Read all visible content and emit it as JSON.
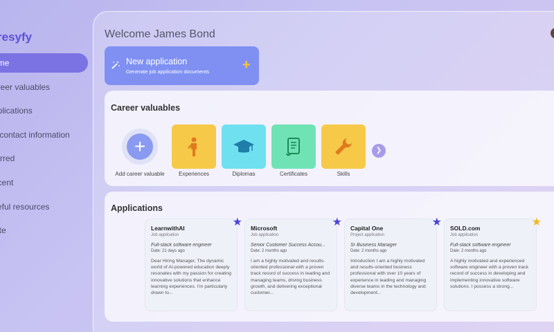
{
  "brand": {
    "name": "resyfy"
  },
  "nav": {
    "items": [
      {
        "label": "ome",
        "active": true
      },
      {
        "label": "areer valuables",
        "active": false
      },
      {
        "label": "pplications",
        "active": false
      },
      {
        "label": "y contact information",
        "active": false
      },
      {
        "label": "tarred",
        "active": false
      },
      {
        "label": "ecent",
        "active": false
      },
      {
        "label": "seful resources",
        "active": false
      },
      {
        "label": "vite",
        "active": false
      }
    ]
  },
  "header": {
    "welcome": "Welcome James Bond"
  },
  "new_application": {
    "title": "New application",
    "subtitle": "Generate job application documents",
    "icon": "magic-wand-icon",
    "action_icon": "plus-icon"
  },
  "career": {
    "title": "Career valuables",
    "add_label": "Add career valuable",
    "tiles": [
      {
        "label": "Experiences",
        "icon": "person-icon",
        "color": "#f7c948"
      },
      {
        "label": "Diplomas",
        "icon": "graduation-cap-icon",
        "color": "#6fe0f0"
      },
      {
        "label": "Certificates",
        "icon": "scroll-icon",
        "color": "#6fe3b4"
      },
      {
        "label": "Skills",
        "icon": "wrench-icon",
        "color": "#f7c948"
      }
    ]
  },
  "applications": {
    "title": "Applications",
    "cards": [
      {
        "company": "LearnwithAI",
        "type": "Job application",
        "role": "Full-stack software engineer",
        "date": "Date: 21 days ago",
        "body": "Dear Hiring Manager, The dynamic world of AI-powered education deeply resonates with my passion for creating innovative solutions that enhance learning experiences. I'm particularly drawn to...",
        "star_color": "#4b45d6"
      },
      {
        "company": "Microsoft",
        "type": "Job application",
        "role": "Senior Customer Success Accou...",
        "date": "Date: 2 months ago",
        "body": "I am a highly motivated and results-oriented professional with a proven track record of success in leading and managing teams, driving business growth, and delivering exceptional customer...",
        "star_color": "#4b45d6"
      },
      {
        "company": "Capital One",
        "type": "Project application",
        "role": "Sr Business Manager",
        "date": "Date: 2 months ago",
        "body": "Introduction I am a highly motivated and results-oriented business professional with over 10 years of experience in leading and managing diverse teams in the technology and development...",
        "star_color": "#4b45d6"
      },
      {
        "company": "SOLD.com",
        "type": "Job application",
        "role": "Full-stack software engineer",
        "date": "Date: 2 months ago",
        "body": "A highly motivated and experienced software engineer with a proven track record of success in developing and implementing innovative software solutions. I possess a strong...",
        "star_color": "#f2b61f"
      }
    ]
  }
}
